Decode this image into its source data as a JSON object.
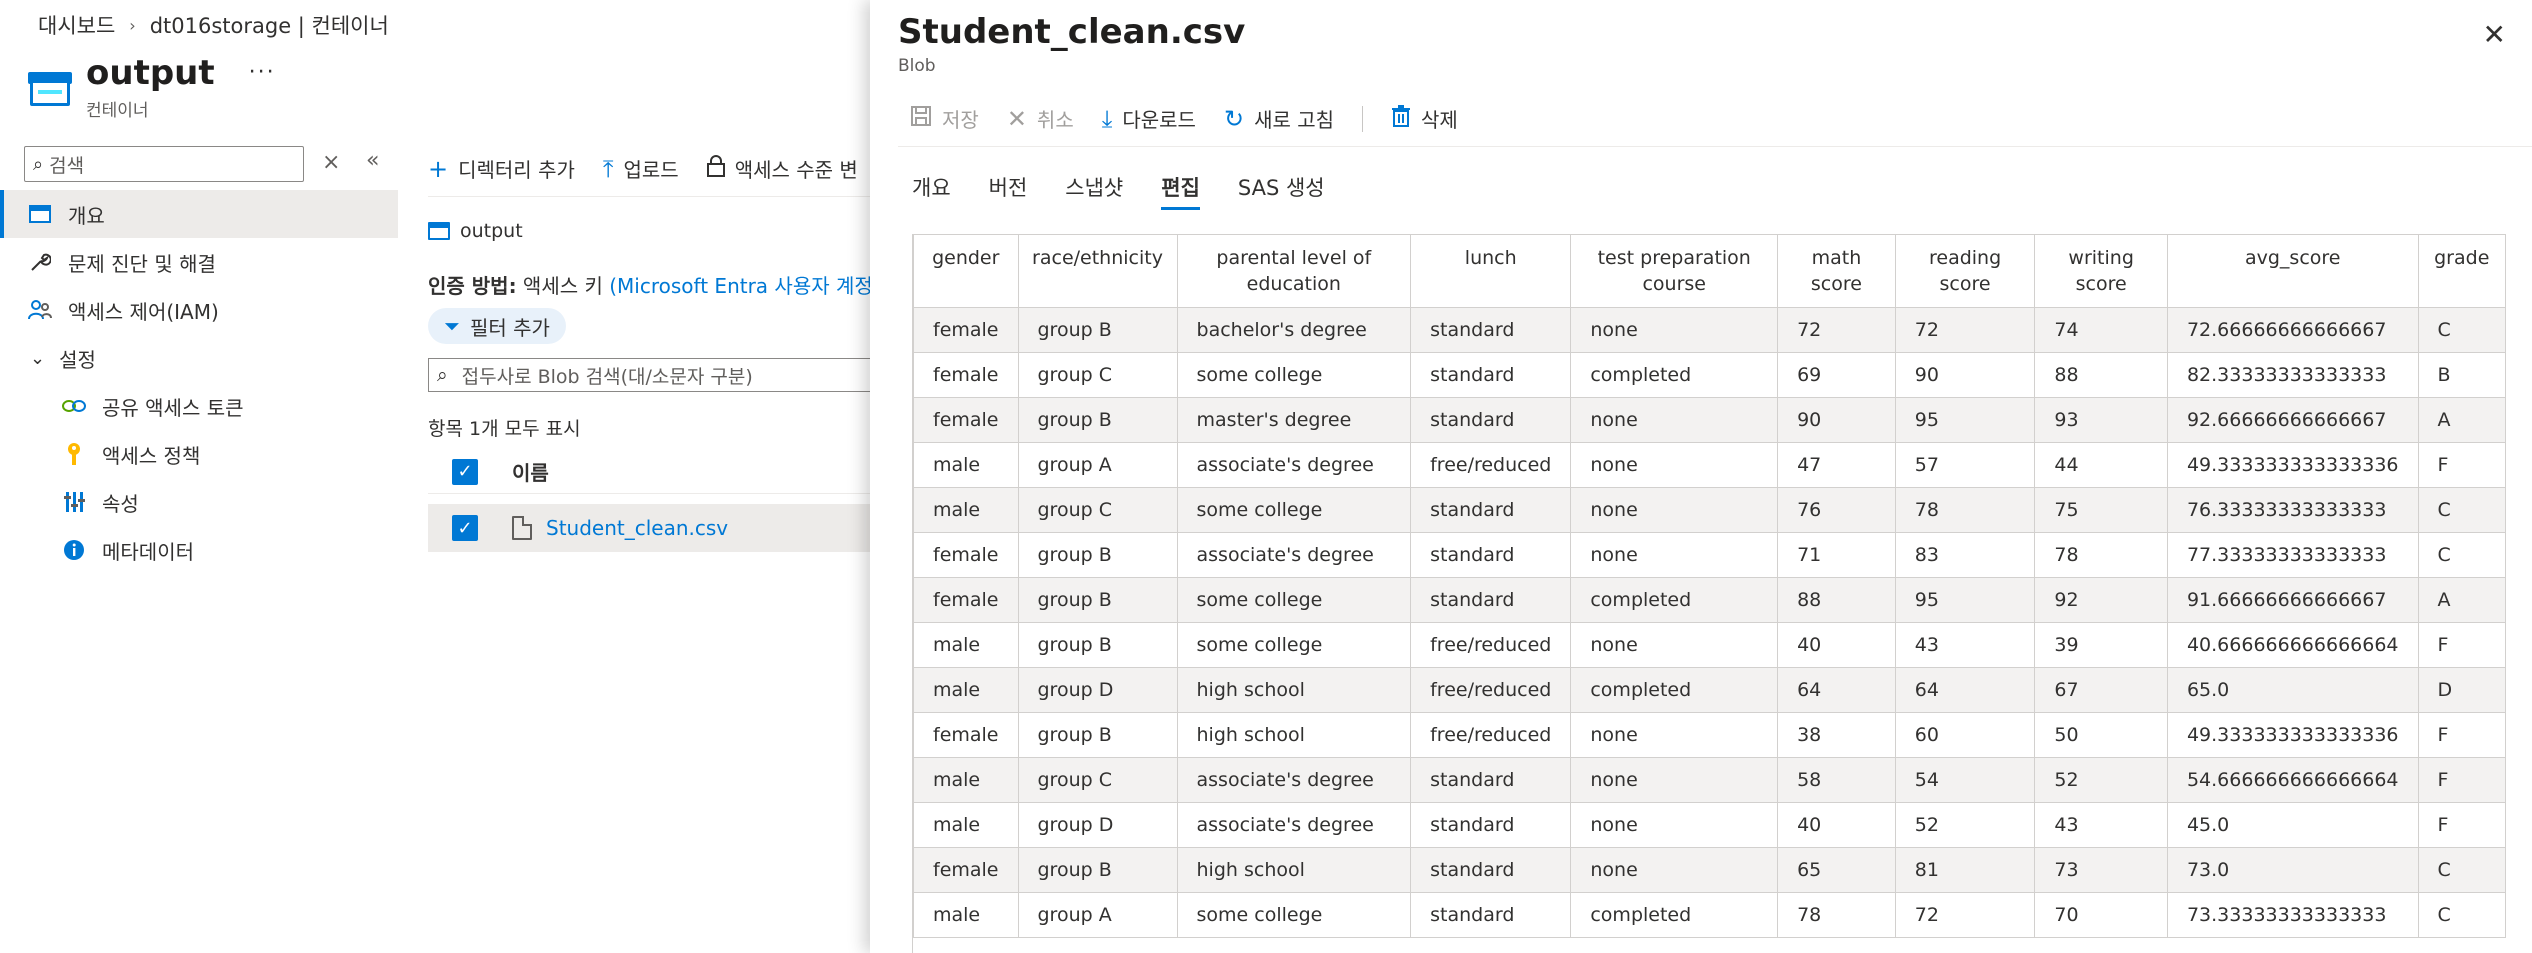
{
  "breadcrumb": [
    "대시보드",
    "dt016storage | 컨테이너"
  ],
  "page": {
    "title": "output",
    "subtitle": "컨테이너",
    "more": "···"
  },
  "search": {
    "placeholder": "검색"
  },
  "nav": [
    {
      "label": "개요",
      "icon": "overview-icon",
      "active": true
    },
    {
      "label": "문제 진단 및 해결",
      "icon": "wrench-icon"
    },
    {
      "label": "액세스 제어(IAM)",
      "icon": "people-icon"
    },
    {
      "label": "설정",
      "icon": "chevron-down-icon",
      "group": true
    },
    {
      "label": "공유 액세스 토큰",
      "icon": "link-icon",
      "child": true
    },
    {
      "label": "액세스 정책",
      "icon": "key-icon",
      "child": true
    },
    {
      "label": "속성",
      "icon": "properties-icon",
      "child": true
    },
    {
      "label": "메타데이터",
      "icon": "info-icon",
      "child": true
    }
  ],
  "commands": {
    "add_dir": "디렉터리 추가",
    "upload": "업로드",
    "access_level": "액세스 수준 변"
  },
  "content": {
    "crumb": "output",
    "auth_label": "인증 방법:",
    "auth_value": "액세스 키",
    "auth_link": "(Microsoft Entra 사용자 계정으로",
    "filter": "필터 추가",
    "blob_search_placeholder": "접두사로 Blob 검색(대/소문자 구분)",
    "count": "항목 1개 모두 표시",
    "name_header": "이름",
    "file": "Student_clean.csv"
  },
  "panel": {
    "title": "Student_clean.csv",
    "subtitle": "Blob",
    "toolbar": {
      "save": "저장",
      "cancel": "취소",
      "download": "다운로드",
      "refresh": "새로 고침",
      "delete": "삭제"
    },
    "tabs": [
      "개요",
      "버전",
      "스냅샷",
      "편집",
      "SAS 생성"
    ],
    "active_tab": "편집",
    "columns": [
      "gender",
      "race/ethnicity",
      "parental level of education",
      "lunch",
      "test preparation course",
      "math score",
      "reading score",
      "writing score",
      "avg_score",
      "grade"
    ],
    "rows": [
      [
        "female",
        "group B",
        "bachelor's degree",
        "standard",
        "none",
        "72",
        "72",
        "74",
        "72.66666666666667",
        "C"
      ],
      [
        "female",
        "group C",
        "some college",
        "standard",
        "completed",
        "69",
        "90",
        "88",
        "82.33333333333333",
        "B"
      ],
      [
        "female",
        "group B",
        "master's degree",
        "standard",
        "none",
        "90",
        "95",
        "93",
        "92.66666666666667",
        "A"
      ],
      [
        "male",
        "group A",
        "associate's degree",
        "free/reduced",
        "none",
        "47",
        "57",
        "44",
        "49.333333333333336",
        "F"
      ],
      [
        "male",
        "group C",
        "some college",
        "standard",
        "none",
        "76",
        "78",
        "75",
        "76.33333333333333",
        "C"
      ],
      [
        "female",
        "group B",
        "associate's degree",
        "standard",
        "none",
        "71",
        "83",
        "78",
        "77.33333333333333",
        "C"
      ],
      [
        "female",
        "group B",
        "some college",
        "standard",
        "completed",
        "88",
        "95",
        "92",
        "91.66666666666667",
        "A"
      ],
      [
        "male",
        "group B",
        "some college",
        "free/reduced",
        "none",
        "40",
        "43",
        "39",
        "40.666666666666664",
        "F"
      ],
      [
        "male",
        "group D",
        "high school",
        "free/reduced",
        "completed",
        "64",
        "64",
        "67",
        "65.0",
        "D"
      ],
      [
        "female",
        "group B",
        "high school",
        "free/reduced",
        "none",
        "38",
        "60",
        "50",
        "49.333333333333336",
        "F"
      ],
      [
        "male",
        "group C",
        "associate's degree",
        "standard",
        "none",
        "58",
        "54",
        "52",
        "54.666666666666664",
        "F"
      ],
      [
        "male",
        "group D",
        "associate's degree",
        "standard",
        "none",
        "40",
        "52",
        "43",
        "45.0",
        "F"
      ],
      [
        "female",
        "group B",
        "high school",
        "standard",
        "none",
        "65",
        "81",
        "73",
        "73.0",
        "C"
      ],
      [
        "male",
        "group A",
        "some college",
        "standard",
        "completed",
        "78",
        "72",
        "70",
        "73.33333333333333",
        "C"
      ]
    ]
  }
}
